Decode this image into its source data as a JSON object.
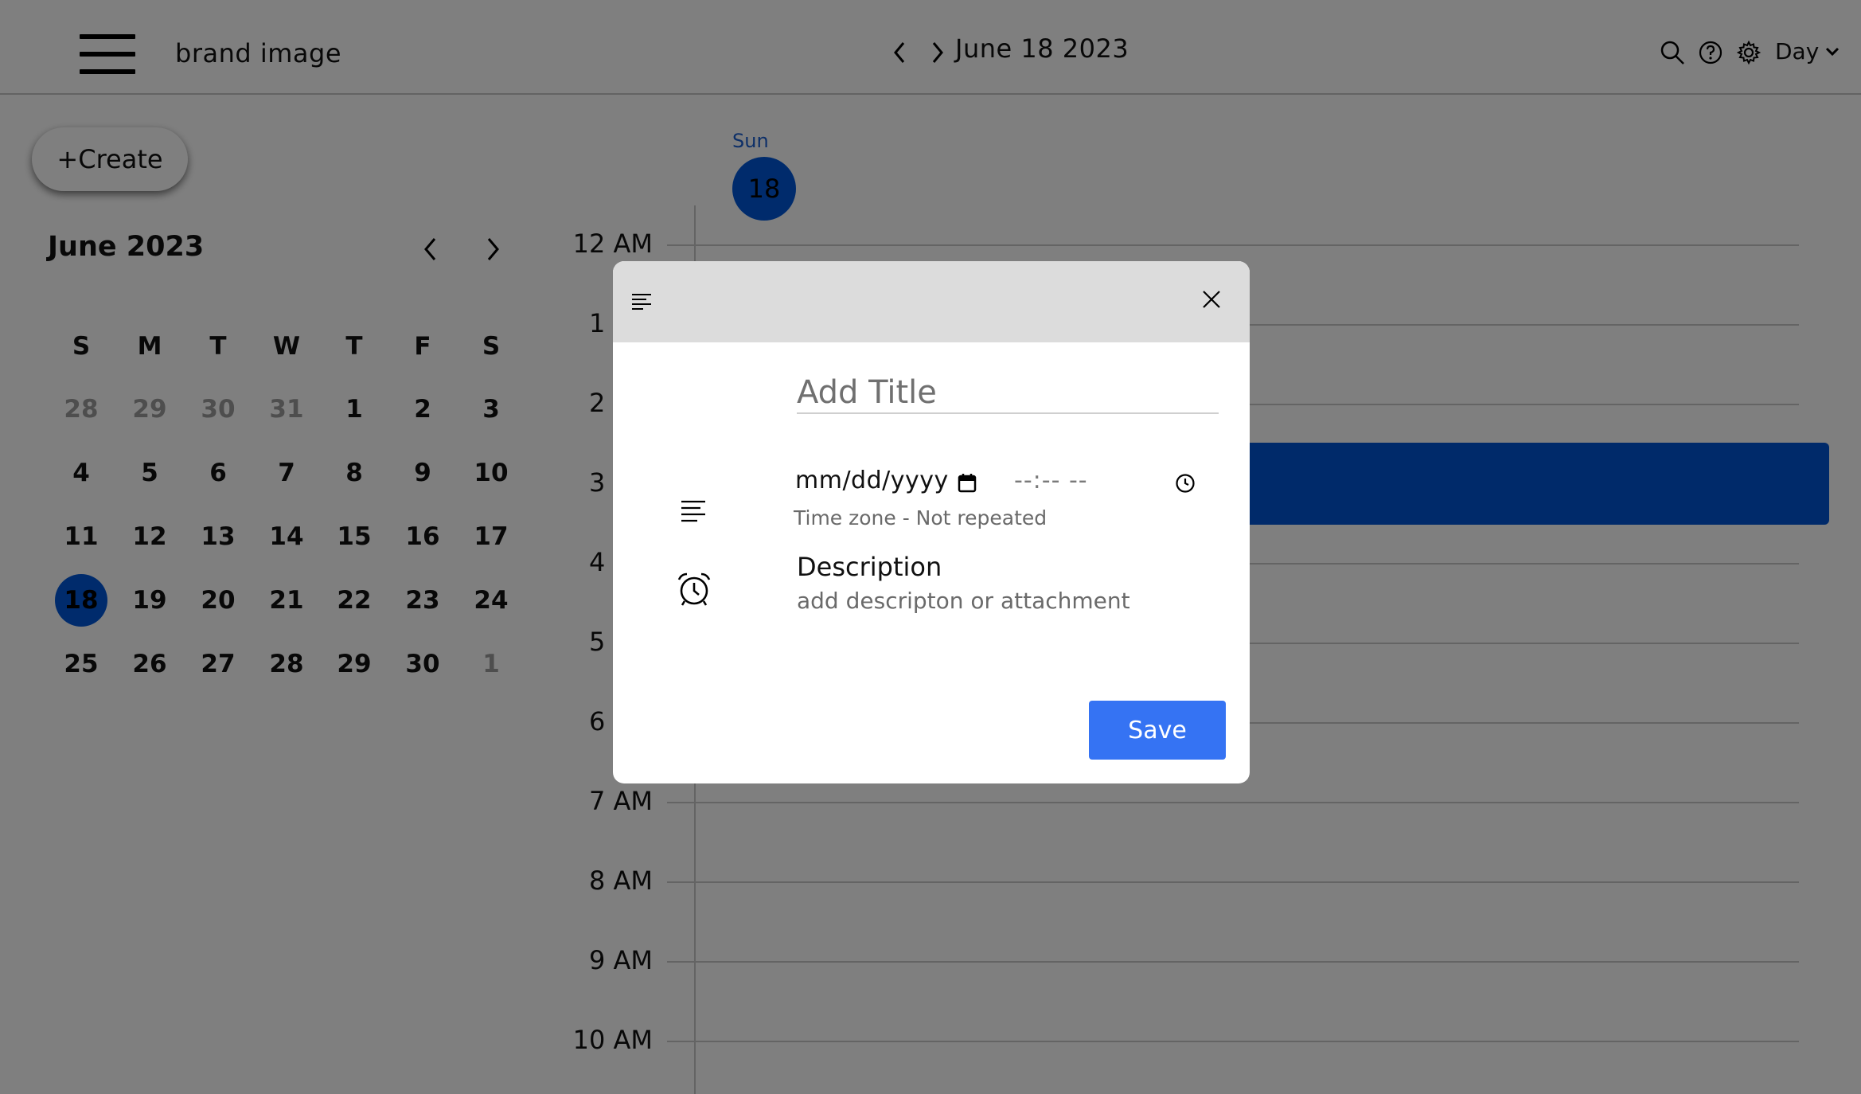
{
  "header": {
    "brand": "brand image",
    "current_date": "June 18 2023",
    "view_label": "Day"
  },
  "sidebar": {
    "create_label": "+Create",
    "month_title": "June 2023",
    "weekday_headers": [
      "S",
      "M",
      "T",
      "W",
      "T",
      "F",
      "S"
    ],
    "weeks": [
      [
        "28",
        "29",
        "30",
        "31",
        "1",
        "2",
        "3"
      ],
      [
        "4",
        "5",
        "6",
        "7",
        "8",
        "9",
        "10"
      ],
      [
        "11",
        "12",
        "13",
        "14",
        "15",
        "16",
        "17"
      ],
      [
        "18",
        "19",
        "20",
        "21",
        "22",
        "23",
        "24"
      ],
      [
        "25",
        "26",
        "27",
        "28",
        "29",
        "30",
        "1"
      ]
    ],
    "selected_day": "18"
  },
  "day_view": {
    "day_name": "Sun",
    "day_number": "18",
    "hours": [
      "12 AM",
      "1 AM",
      "2 AM",
      "3 AM",
      "4 AM",
      "5 AM",
      "6 AM",
      "7 AM",
      "8 AM",
      "9 AM",
      "10 AM"
    ]
  },
  "modal": {
    "title_placeholder": "Add Title",
    "date_placeholder": "mm/dd/yyyy",
    "time_placeholder": "--:-- --",
    "timezone_note": "Time zone - Not repeated",
    "description_label": "Description",
    "description_placeholder": "add descripton or attachment",
    "save_label": "Save"
  },
  "colors": {
    "accent": "#0057d8",
    "save_button": "#3573f3",
    "overlay": "rgba(0,0,0,0.5)"
  },
  "icons": {
    "menu": "hamburger-icon",
    "search": "search-icon",
    "help": "help-icon",
    "settings": "gear-icon",
    "close": "close-icon",
    "alarm": "alarm-clock-icon"
  }
}
